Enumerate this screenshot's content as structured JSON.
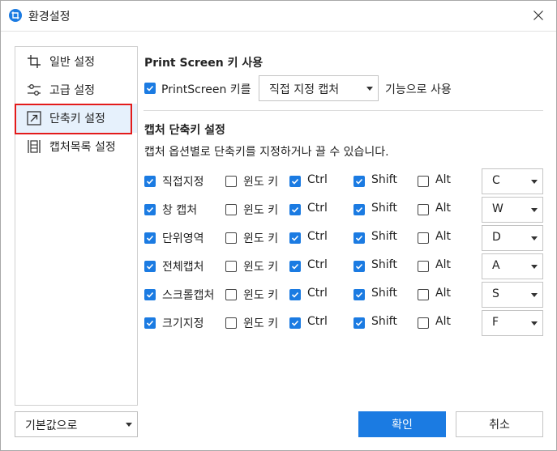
{
  "window": {
    "title": "환경설정"
  },
  "sidebar": {
    "items": [
      {
        "label": "일반 설정",
        "icon": "crop-icon"
      },
      {
        "label": "고급 설정",
        "icon": "sliders-icon"
      },
      {
        "label": "단축키 설정",
        "icon": "shortcut-arrow-icon",
        "active": true
      },
      {
        "label": "캡처목록 설정",
        "icon": "capture-list-icon"
      }
    ],
    "defaults_label": "기본값으로"
  },
  "printscreen": {
    "title": "Print Screen 키 사용",
    "checkbox_label": "PrintScreen 키를",
    "checked": true,
    "select_value": "직접 지정 캡처",
    "suffix": "기능으로 사용"
  },
  "shortcuts": {
    "title": "캡처 단축키 설정",
    "description": "캡처 옵션별로 단축키를 지정하거나 끌 수 있습니다.",
    "win_label": "윈도 키",
    "ctrl_label": "Ctrl",
    "shift_label": "Shift",
    "alt_label": "Alt",
    "rows": [
      {
        "name": "직접지정",
        "enabled": true,
        "win": false,
        "ctrl": true,
        "shift": true,
        "alt": false,
        "key": "C"
      },
      {
        "name": "창 캡처",
        "enabled": true,
        "win": false,
        "ctrl": true,
        "shift": true,
        "alt": false,
        "key": "W"
      },
      {
        "name": "단위영역",
        "enabled": true,
        "win": false,
        "ctrl": true,
        "shift": true,
        "alt": false,
        "key": "D"
      },
      {
        "name": "전체캡처",
        "enabled": true,
        "win": false,
        "ctrl": true,
        "shift": true,
        "alt": false,
        "key": "A"
      },
      {
        "name": "스크롤캡처",
        "enabled": true,
        "win": false,
        "ctrl": true,
        "shift": true,
        "alt": false,
        "key": "S"
      },
      {
        "name": "크기지정",
        "enabled": true,
        "win": false,
        "ctrl": true,
        "shift": true,
        "alt": false,
        "key": "F"
      }
    ]
  },
  "buttons": {
    "ok": "확인",
    "cancel": "취소"
  },
  "colors": {
    "accent": "#1b7be2",
    "highlight_border": "#e31b1b",
    "active_bg": "#e6f1fc"
  }
}
